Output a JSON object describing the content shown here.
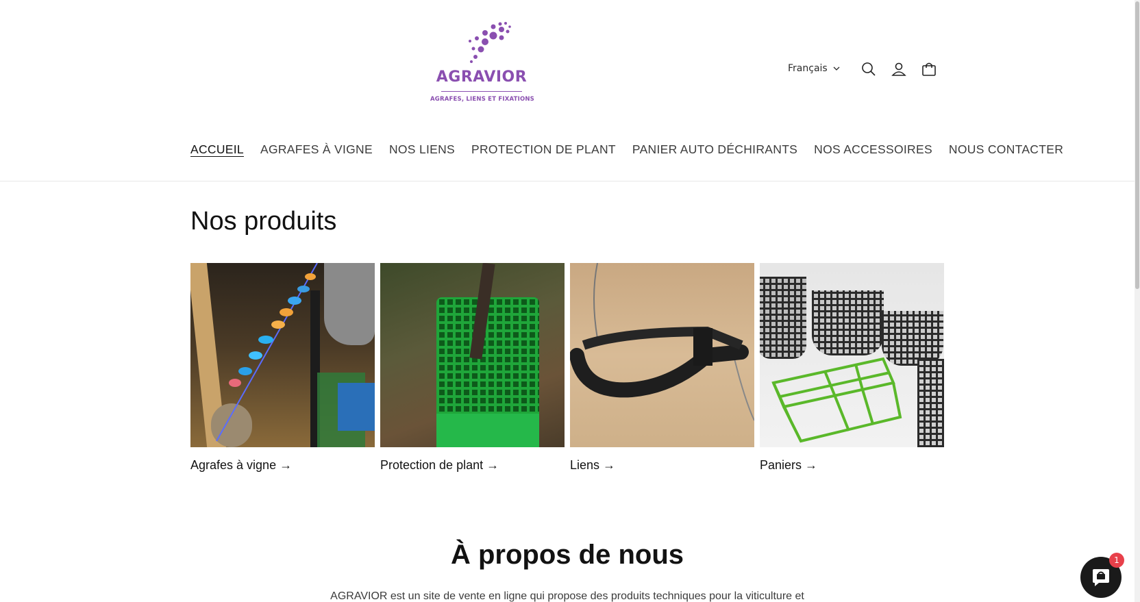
{
  "brand": {
    "name": "AGRAVIOR",
    "tagline": "AGRAFES, LIENS ET FIXATIONS",
    "color": "#8a4fb0"
  },
  "header": {
    "language": "Français",
    "icons": [
      "search-icon",
      "account-icon",
      "cart-icon"
    ]
  },
  "nav": {
    "items": [
      {
        "label": "ACCUEIL",
        "active": true
      },
      {
        "label": "AGRAFES À VIGNE"
      },
      {
        "label": "NOS LIENS"
      },
      {
        "label": "PROTECTION DE PLANT"
      },
      {
        "label": "PANIER AUTO DÉCHIRANTS"
      },
      {
        "label": "NOS ACCESSOIRES"
      },
      {
        "label": "NOUS CONTACTER"
      }
    ]
  },
  "products": {
    "title": "Nos produits",
    "items": [
      {
        "label": "Agrafes à vigne →"
      },
      {
        "label": "Protection de plant →"
      },
      {
        "label": "Liens →"
      },
      {
        "label": "Paniers →"
      }
    ]
  },
  "about": {
    "title": "À propos de nous",
    "text": "AGRAVIOR est un site de vente en ligne qui propose des produits techniques pour la viticulture et"
  },
  "chat": {
    "badge": "1"
  }
}
